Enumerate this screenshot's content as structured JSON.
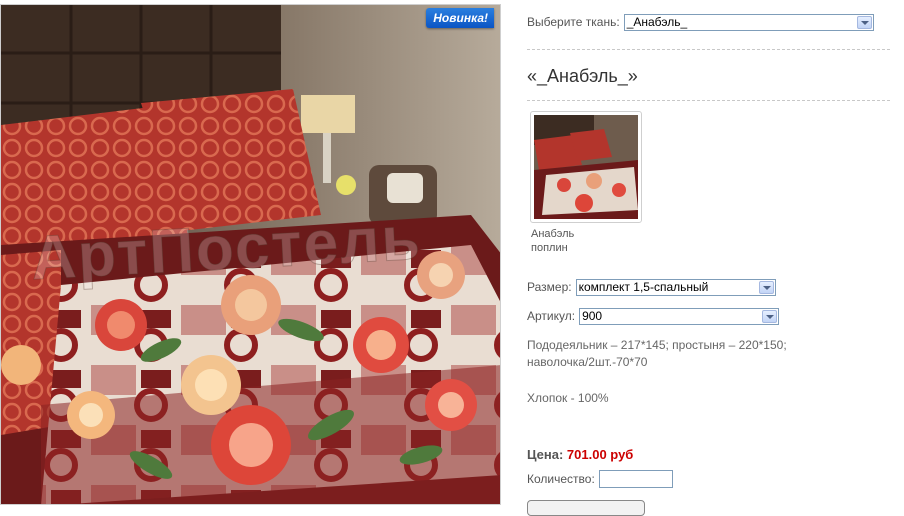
{
  "product_photo": {
    "badge": "Новинка!",
    "watermark": "АртПостель"
  },
  "fabric_select": {
    "label": "Выберите ткань:",
    "selected": "_Анабэль_"
  },
  "product": {
    "title": "«_Анабэль_»",
    "thumb_caption_line1": "Анабэль",
    "thumb_caption_line2": "поплин"
  },
  "size_select": {
    "label": "Размер:",
    "selected": "комплект 1,5-спальный"
  },
  "article_select": {
    "label": "Артикул:",
    "selected": "900"
  },
  "description": {
    "line1": "Пододеяльник – 217*145; простыня – 220*150;",
    "line2": "наволочка/2шт.-70*70",
    "material": "Хлопок - 100%"
  },
  "price": {
    "label": "Цена:",
    "amount": "701.00 руб"
  },
  "quantity": {
    "label": "Количество:",
    "value": ""
  },
  "colors": {
    "price": "#cc0000",
    "badge": "#1565d8",
    "fabric_red": "#a82a24",
    "fabric_maroon": "#6b1a1a"
  }
}
